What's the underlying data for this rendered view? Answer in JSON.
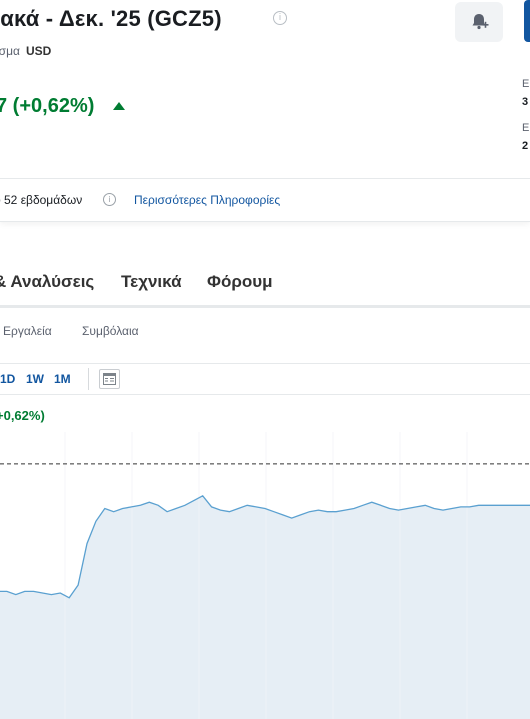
{
  "header": {
    "title": "ιακά - Δεκ. '25 (GCZ5)",
    "info_glyph": "i",
    "bell_icon": "bell-plus-icon",
    "currency_prefix": "ισμα",
    "currency": "USD",
    "change_text": "7 (+0,62%)",
    "change_color": "#007c32",
    "side_label_1": "E",
    "side_value_1": "3",
    "side_label_2": "E",
    "side_value_2": "2",
    "range_label": "ό 52 εβδομάδων",
    "more_info": "Περισσότερες Πληροφορίες"
  },
  "tabs": [
    {
      "label": "& Αναλύσεις"
    },
    {
      "label": "Τεχνικά"
    },
    {
      "label": "Φόρουμ"
    }
  ],
  "subtabs": [
    {
      "label": "Εργαλεία"
    },
    {
      "label": "Συμβόλαια"
    }
  ],
  "toolbar": {
    "timeframes": [
      "1D",
      "1W",
      "1M"
    ],
    "chart_type_icon": "chart-settings-icon"
  },
  "chart_change": "+0,62%)",
  "chart_data": {
    "type": "area",
    "line_color": "#5aa0d0",
    "fill_color": "#e3ecf4",
    "reference_line": "dashed",
    "grid": true,
    "values": [
      60,
      60,
      59,
      60,
      60,
      59.5,
      59,
      59.5,
      58,
      62,
      75,
      82,
      86,
      85,
      86,
      86.5,
      87,
      88,
      87,
      85,
      86,
      87,
      88.5,
      90,
      86.5,
      85.5,
      85,
      86,
      87,
      86.5,
      86,
      85,
      84,
      83,
      84,
      85,
      85.5,
      85,
      85,
      85.5,
      86,
      87,
      88,
      87,
      86,
      85.5,
      86,
      86.5,
      87,
      86,
      85.5,
      86,
      86.5,
      86.5,
      87,
      87,
      87,
      87,
      87,
      87,
      87
    ],
    "reference": 100,
    "ylim": [
      20,
      110
    ]
  }
}
